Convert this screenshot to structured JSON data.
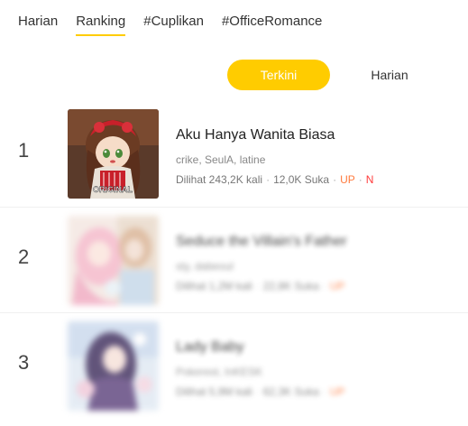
{
  "top_tabs": [
    "Harian",
    "Ranking",
    "#Cuplikan",
    "#OfficeRomance"
  ],
  "active_top_tab": "Ranking",
  "sub_tabs": {
    "active": "Terkini",
    "other": "Harian"
  },
  "list": [
    {
      "rank": "1",
      "thumb_badge": "ORIGINAL",
      "title": "Aku Hanya Wanita Biasa",
      "authors": "crike, SeulA, latine",
      "views": "Dilihat 243,2K kali",
      "likes": "12,0K Suka",
      "up": "UP",
      "new": "N"
    },
    {
      "rank": "2",
      "title": "Seduce the Villain's Father",
      "authors": "sty, dabeoul",
      "views": "Dilihat 1,2M kali",
      "likes": "22,8K Suka",
      "up": "UP"
    },
    {
      "rank": "3",
      "title": "Lady Baby",
      "authors": "Pokerest, InKESK",
      "views": "Dilihat 5,9M kali",
      "likes": "62,3K Suka",
      "up": "UP"
    }
  ],
  "colors": {
    "accent": "#ffcc00",
    "up": "#ff7a3d",
    "new": "#ff3b3b"
  },
  "icons": [
    "comic-thumbnail-1",
    "comic-thumbnail-2",
    "comic-thumbnail-3"
  ]
}
